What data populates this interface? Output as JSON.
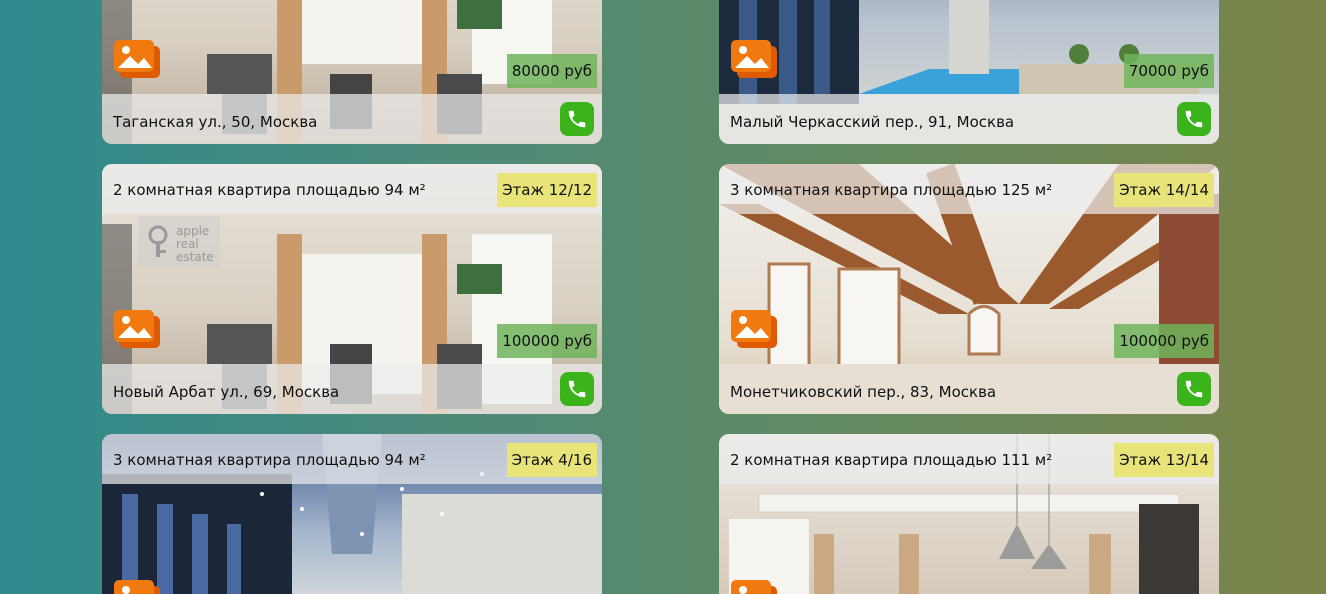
{
  "colors": {
    "floor_badge": "#e8e47a",
    "price_badge": "#6eb45a",
    "phone_button": "#3bb31a",
    "gallery_icon": "#f07a10"
  },
  "listings": [
    {
      "title": "",
      "floor": "",
      "price": "80000 руб",
      "address": "Таганская ул., 50, Москва",
      "icons": [
        "gallery-icon",
        "phone-icon"
      ]
    },
    {
      "title": "",
      "floor": "",
      "price": "70000 руб",
      "address": "Малый Черкасский пер., 91, Москва",
      "icons": [
        "gallery-icon",
        "phone-icon"
      ]
    },
    {
      "title": "2 комнатная квартира площадью 94 м²",
      "floor": "Этаж 12/12",
      "price": "100000 руб",
      "address": "Новый Арбат ул., 69, Москва",
      "logo": [
        "apple",
        "real",
        "estate"
      ],
      "icons": [
        "gallery-icon",
        "phone-icon"
      ]
    },
    {
      "title": "3 комнатная квартира площадью 125 м²",
      "floor": "Этаж 14/14",
      "price": "100000 руб",
      "address": "Монетчиковский пер., 83, Москва",
      "icons": [
        "gallery-icon",
        "phone-icon"
      ]
    },
    {
      "title": "3 комнатная квартира площадью 94 м²",
      "floor": "Этаж 4/16",
      "price": "",
      "address": "",
      "icons": [
        "gallery-icon"
      ]
    },
    {
      "title": "2 комнатная квартира площадью 111 м²",
      "floor": "Этаж 13/14",
      "price": "",
      "address": "",
      "icons": [
        "gallery-icon"
      ]
    }
  ]
}
